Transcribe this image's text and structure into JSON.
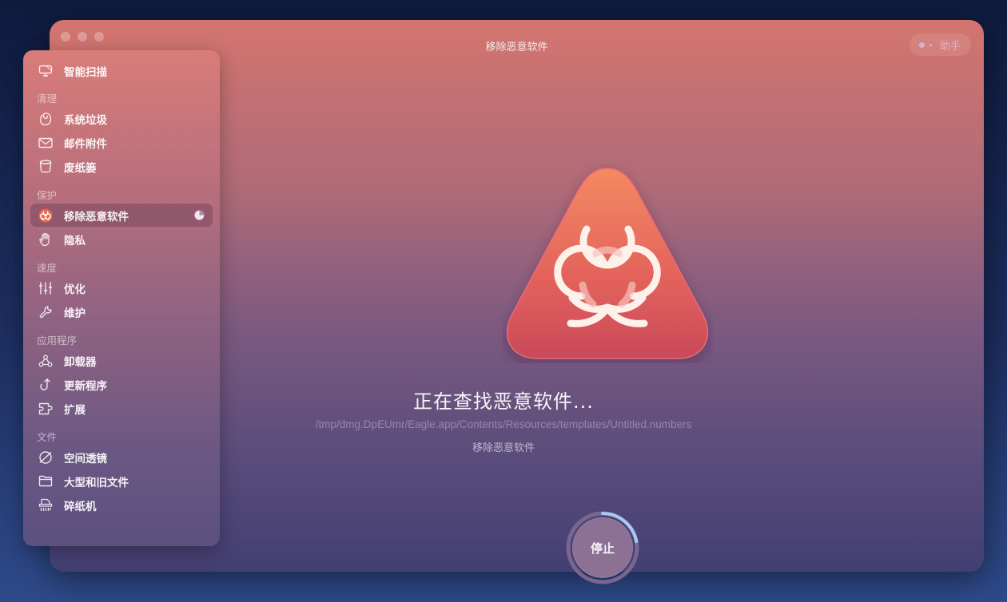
{
  "window": {
    "title": "移除恶意软件",
    "assistant_label": "助手"
  },
  "sidebar": {
    "top_item": {
      "label": "智能扫描",
      "icon": "monitor-icon"
    },
    "sections": [
      {
        "label": "清理",
        "items": [
          {
            "label": "系统垃圾",
            "icon": "trash-swirl-icon"
          },
          {
            "label": "邮件附件",
            "icon": "mail-icon"
          },
          {
            "label": "废纸篓",
            "icon": "bin-icon"
          }
        ]
      },
      {
        "label": "保护",
        "items": [
          {
            "label": "移除恶意软件",
            "icon": "biohazard-icon",
            "active": true,
            "progress_indicator": "pie-progress-icon"
          },
          {
            "label": "隐私",
            "icon": "hand-icon"
          }
        ]
      },
      {
        "label": "速度",
        "items": [
          {
            "label": "优化",
            "icon": "sliders-icon"
          },
          {
            "label": "维护",
            "icon": "wrench-icon"
          }
        ]
      },
      {
        "label": "应用程序",
        "items": [
          {
            "label": "卸载器",
            "icon": "apps-icon"
          },
          {
            "label": "更新程序",
            "icon": "update-arrow-icon"
          },
          {
            "label": "扩展",
            "icon": "puzzle-icon"
          }
        ]
      },
      {
        "label": "文件",
        "items": [
          {
            "label": "空间透镜",
            "icon": "planet-icon"
          },
          {
            "label": "大型和旧文件",
            "icon": "folder-icon"
          },
          {
            "label": "碎纸机",
            "icon": "shredder-icon"
          }
        ]
      }
    ]
  },
  "main": {
    "heading": "正在查找恶意软件...",
    "current_path": "/tmp/dmg.DpEUmr/Eagle.app/Contents/Resources/templates/Untitled.numbers",
    "subtitle": "移除恶意软件",
    "stop_label": "停止",
    "scan_progress": 0.22
  },
  "colors": {
    "accent_orange": "#f28a5f",
    "accent_red": "#d9525a",
    "progress_ring": "#a9c8f5"
  }
}
